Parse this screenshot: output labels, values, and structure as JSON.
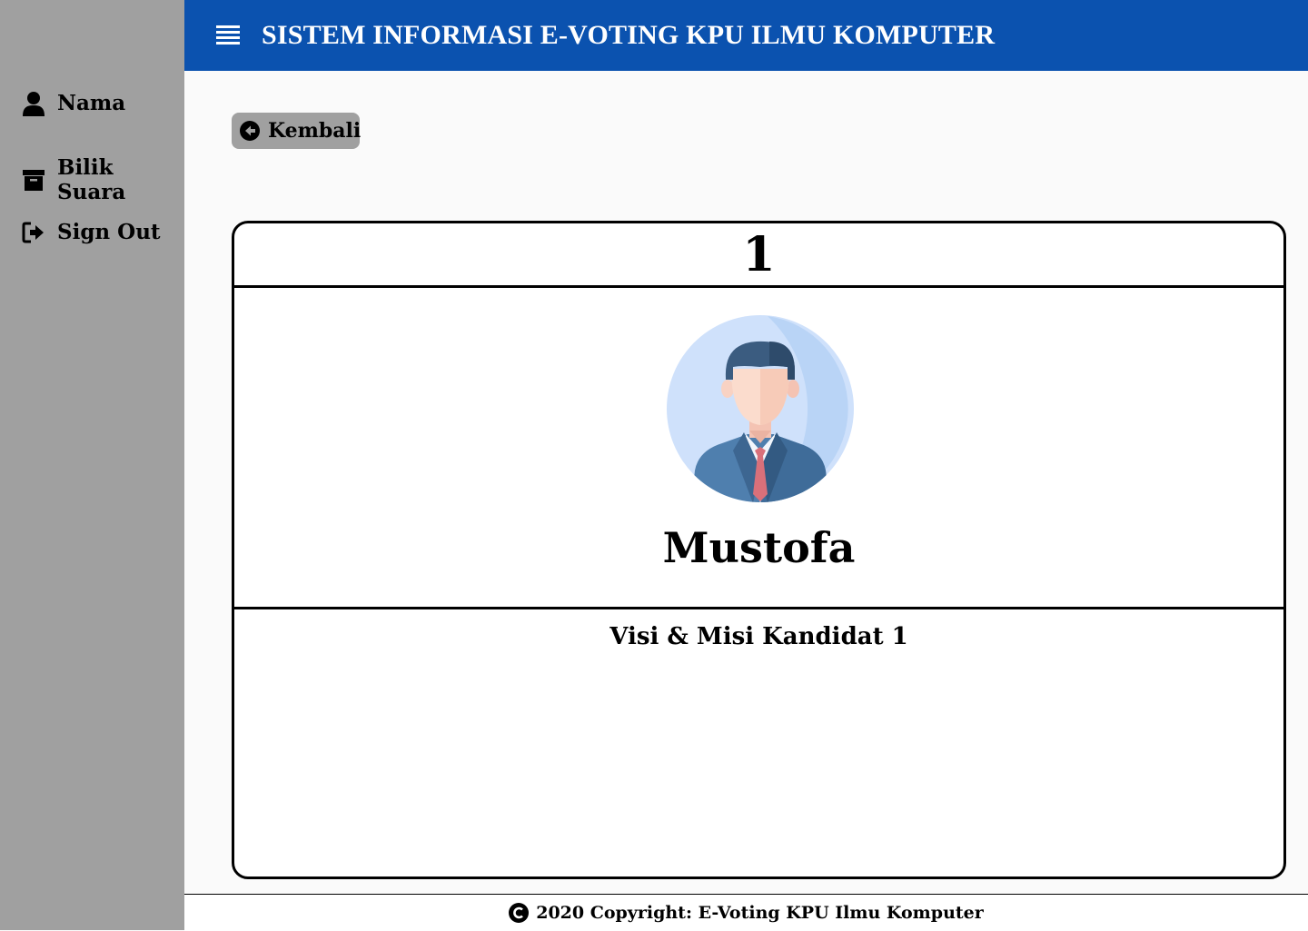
{
  "header": {
    "title": "SISTEM INFORMASI E-VOTING KPU ILMU KOMPUTER",
    "menu_icon": "hamburger-menu-icon",
    "color": "#0b52af"
  },
  "sidebar": {
    "background": "#a0a0a0",
    "items": [
      {
        "label": "Nama",
        "icon": "user-icon"
      },
      {
        "label": "Bilik Suara",
        "icon": "archive-box-icon"
      },
      {
        "label": "Sign Out",
        "icon": "sign-out-icon"
      }
    ]
  },
  "back_button": {
    "label": "Kembali",
    "icon": "arrow-circle-left-icon"
  },
  "candidate": {
    "number": "1",
    "name": "Mustofa",
    "avatar_icon": "businessman-avatar-icon",
    "vision_mission_title": "Visi & Misi Kandidat 1"
  },
  "footer": {
    "text": "2020 Copyright: E-Voting KPU Ilmu Komputer",
    "icon": "copyright-icon"
  }
}
